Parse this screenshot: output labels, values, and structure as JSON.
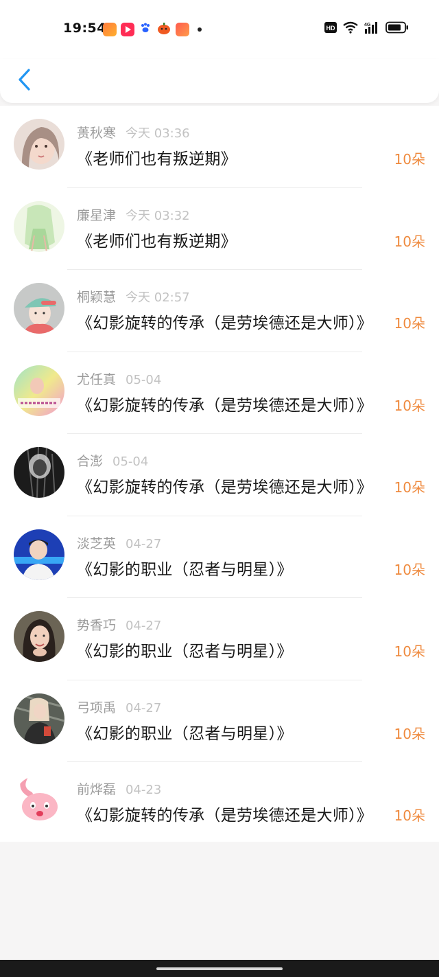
{
  "status_bar": {
    "time": "19:54",
    "notification_icons": [
      "app-icon-1",
      "video-icon",
      "paw-icon",
      "pumpkin-icon",
      "app-icon-2"
    ],
    "system_icons": [
      "hd-icon",
      "wifi-icon",
      "4g-signal-icon",
      "battery-icon"
    ]
  },
  "nav": {
    "back_icon": "chevron-left-icon",
    "accent": "#2196f3"
  },
  "colors": {
    "amount": "#ef8a3e",
    "name": "#9c9c9c",
    "date": "#c2c2c2"
  },
  "gifts": [
    {
      "name": "蒉秋寒",
      "date": "今天 03:36",
      "book": "《老师们也有叛逆期》",
      "amount": "10朵",
      "avatar": "portrait-woman-1"
    },
    {
      "name": "廉星津",
      "date": "今天 03:32",
      "book": "《老师们也有叛逆期》",
      "amount": "10朵",
      "avatar": "illustration-girl-green"
    },
    {
      "name": "桐颖慧",
      "date": "今天 02:57",
      "book": "《幻影旋转的传承（是劳埃德还是大师）》",
      "amount": "10朵",
      "avatar": "cartoon-girl-cap"
    },
    {
      "name": "尤任真",
      "date": "05-04",
      "book": "《幻影旋转的传承（是劳埃德还是大师）》",
      "amount": "10朵",
      "avatar": "colorful-text-image"
    },
    {
      "name": "合澎",
      "date": "05-04",
      "book": "《幻影旋转的传承（是劳埃德还是大师）》",
      "amount": "10朵",
      "avatar": "dark-abstract"
    },
    {
      "name": "淡芝英",
      "date": "04-27",
      "book": "《幻影的职业（忍者与明星）》",
      "amount": "10朵",
      "avatar": "boy-blue-stage"
    },
    {
      "name": "势香巧",
      "date": "04-27",
      "book": "《幻影的职业（忍者与明星）》",
      "amount": "10朵",
      "avatar": "portrait-woman-2"
    },
    {
      "name": "弓项禹",
      "date": "04-27",
      "book": "《幻影的职业（忍者与明星）》",
      "amount": "10朵",
      "avatar": "portrait-woman-3"
    },
    {
      "name": "前烨磊",
      "date": "04-23",
      "book": "《幻影旋转的传承（是劳埃德还是大师）》",
      "amount": "10朵",
      "avatar": "pink-rabbit-cartoon"
    }
  ]
}
